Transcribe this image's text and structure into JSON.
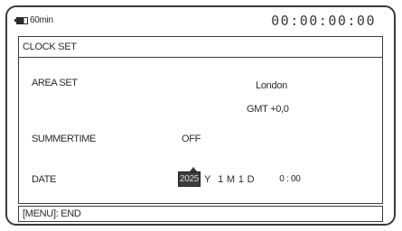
{
  "status": {
    "battery_time": "60min",
    "timecode": "00:00:00:00"
  },
  "menu": {
    "title": "CLOCK SET",
    "area_set": {
      "label": "AREA SET",
      "city": "London",
      "gmt": "GMT +0,0"
    },
    "summertime": {
      "label": "SUMMERTIME",
      "value": "OFF"
    },
    "date": {
      "label": "DATE",
      "year": "2025",
      "year_unit": "Y",
      "month": "1",
      "month_unit": "M",
      "day": "1",
      "day_unit": "D",
      "time": "0 : 00"
    }
  },
  "footer": {
    "text": "[MENU]: END"
  }
}
